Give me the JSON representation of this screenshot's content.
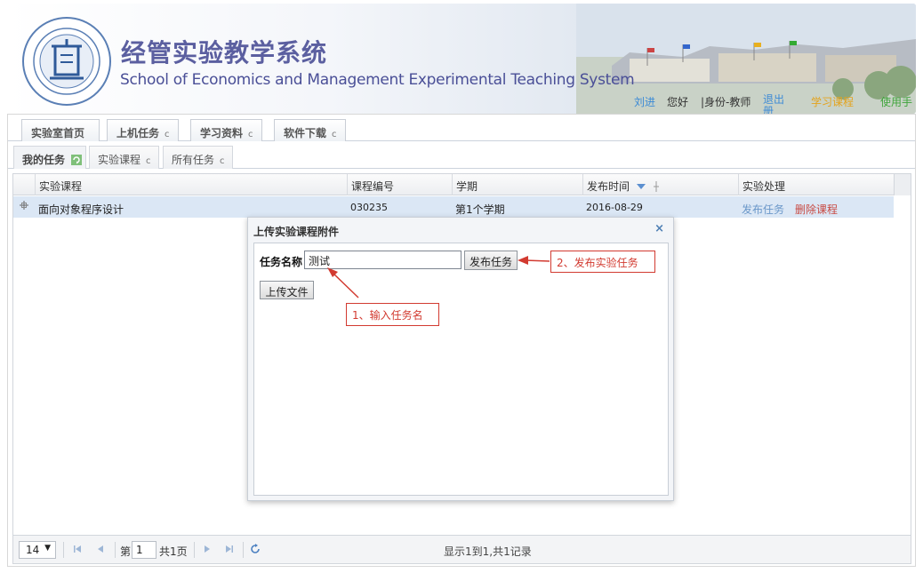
{
  "header": {
    "title_cn": "经管实验教学系统",
    "title_en": "School of Economics and Management Experimental Teaching System",
    "user_name": "刘进",
    "greeting": "您好",
    "role": "|身份-教师",
    "logout": "退出册",
    "study": "学习课程",
    "manual": "使用手"
  },
  "tabs": [
    {
      "label": "实验室首页",
      "suffix": ""
    },
    {
      "label": "上机任务",
      "suffix": "c"
    },
    {
      "label": "学习资料",
      "suffix": "c"
    },
    {
      "label": "软件下载",
      "suffix": "c"
    }
  ],
  "subtabs": [
    {
      "label": "我的任务",
      "suffix": ""
    },
    {
      "label": "实验课程",
      "suffix": "c"
    },
    {
      "label": "所有任务",
      "suffix": "c"
    }
  ],
  "grid": {
    "columns": [
      "实验课程",
      "课程编号",
      "学期",
      "发布时间",
      "实验处理"
    ],
    "rows": [
      {
        "course": "面向对象程序设计",
        "code": "030235",
        "term": "第1个学期",
        "date": "2016-08-29",
        "action_publish": "发布任务",
        "action_delete": "删除课程"
      }
    ]
  },
  "pager": {
    "page_size": "14",
    "page_label": "第",
    "page_value": "1",
    "total_pages": "共1页",
    "info": "显示1到1,共1记录"
  },
  "dialog": {
    "title": "上传实验课程附件",
    "close": "×",
    "task_label": "任务名称",
    "task_value": "测试",
    "publish_button": "发布任务",
    "upload_button": "上传文件"
  },
  "callouts": {
    "step1": "1、输入任务名",
    "step2": "2、发布实验任务"
  },
  "colors": {
    "title": "#5b5fa0",
    "row_selected": "#dbe7f5",
    "callout": "#d23a30",
    "link_blue": "#6a97c9",
    "link_red": "#c84a43"
  }
}
